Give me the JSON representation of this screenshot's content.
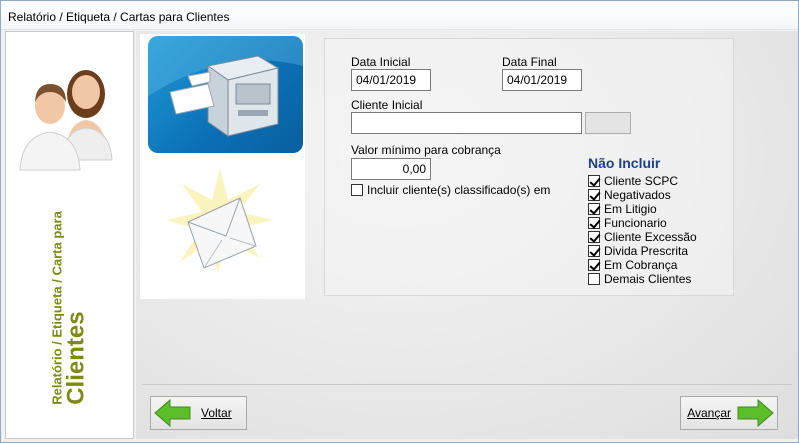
{
  "window": {
    "title": "Relatório / Etiqueta / Cartas para Clientes"
  },
  "sidebar": {
    "caption_line1": "Relatório / Etiqueta / Carta para",
    "caption_line2": "Clientes",
    "icon": "users-avatar-icon"
  },
  "form": {
    "data_inicial": {
      "label": "Data Inicial",
      "value": "04/01/2019"
    },
    "data_final": {
      "label": "Data Final",
      "value": "04/01/2019"
    },
    "cliente_inicial": {
      "label": "Cliente Inicial",
      "value": ""
    },
    "valor_minimo": {
      "label": "Valor mínimo para cobrança",
      "value": "0,00"
    },
    "incluir_classificado": {
      "label": "Incluir cliente(s) classificado(s) em",
      "checked": false
    }
  },
  "nao_incluir": {
    "title": "Não Incluir",
    "items": [
      {
        "label": "Cliente SCPC",
        "checked": true
      },
      {
        "label": "Negativados",
        "checked": true
      },
      {
        "label": "Em Litigio",
        "checked": true
      },
      {
        "label": "Funcionario",
        "checked": true
      },
      {
        "label": "Cliente Excessão",
        "checked": true
      },
      {
        "label": "Divida Prescrita",
        "checked": true
      },
      {
        "label": "Em Cobrança",
        "checked": true
      },
      {
        "label": "Demais Clientes",
        "checked": false
      }
    ]
  },
  "nav": {
    "back_label": "Voltar",
    "next_label": "Avançar"
  },
  "colors": {
    "caption_green": "#7d8a16",
    "section_blue": "#1d3f8c",
    "arrow_green": "#5cbf2a",
    "printer_bg": "#1588cc"
  },
  "illustrations": [
    "printer-icon",
    "letter-envelope-icon"
  ]
}
